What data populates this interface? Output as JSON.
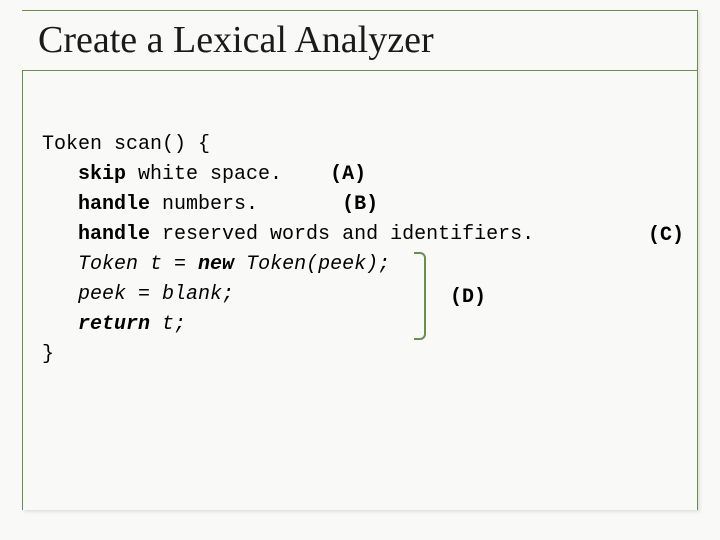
{
  "title": "Create a Lexical Analyzer",
  "code": {
    "l1a": "Token scan() {",
    "l2a": "skip",
    "l2b": " white space.    ",
    "l2c": "(A)",
    "l3a": "handle",
    "l3b": " numbers.       ",
    "l3c": "(B)",
    "l4a": "handle",
    "l4b": " reserved words and identifiers.",
    "l5": "Token t = ",
    "l5b": "new",
    "l5c": " Token(peek);",
    "l6": "peek = blank;",
    "l7a": "return",
    "l7b": " t;",
    "l8": "}"
  },
  "annotations": {
    "c": "(C)",
    "d": "(D)"
  }
}
